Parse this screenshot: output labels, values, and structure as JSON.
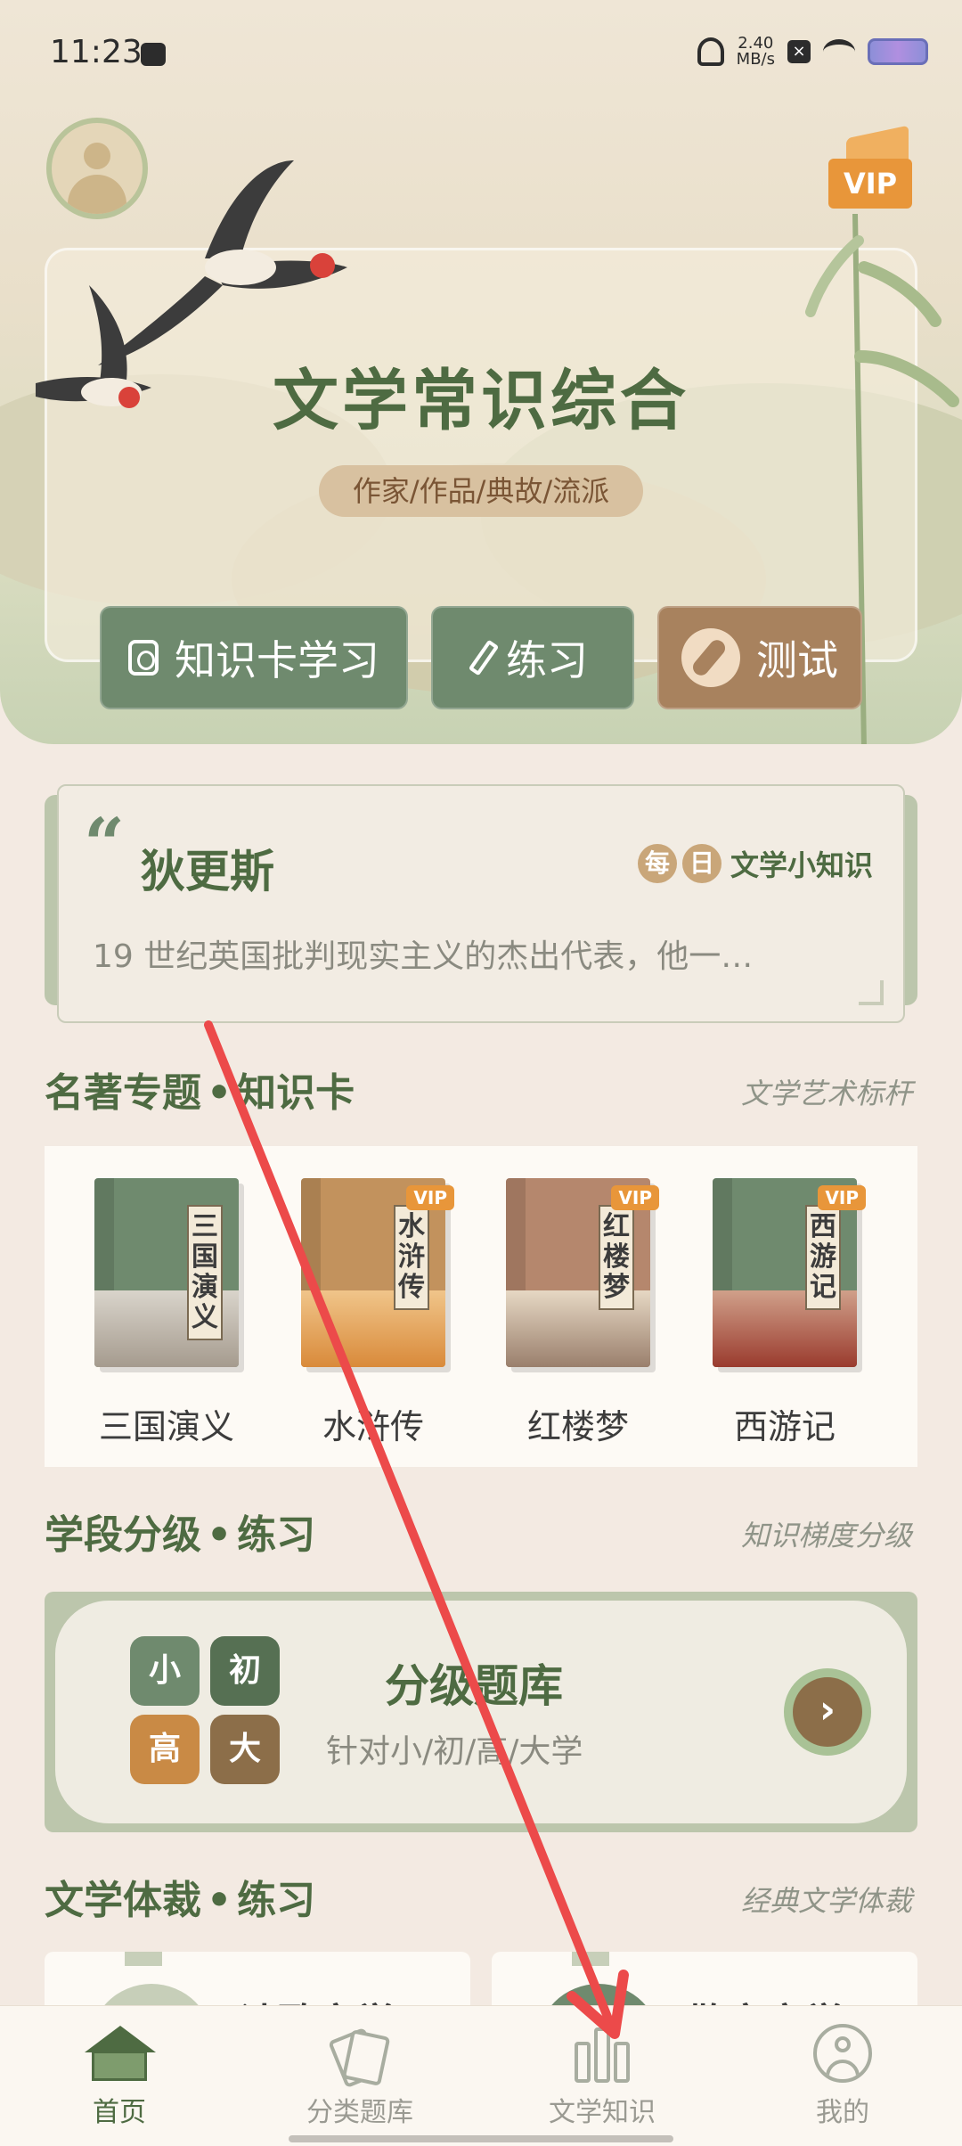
{
  "status_bar": {
    "time": "11:23",
    "speed_value": "2.40",
    "speed_unit": "MB/s",
    "x_label": "×"
  },
  "header": {
    "vip_label": "VIP"
  },
  "hero": {
    "title": "文学常识综合",
    "subtitle": "作家/作品/典故/流派",
    "buttons": {
      "cards": "知识卡学习",
      "practice": "练习",
      "test": "测试"
    }
  },
  "daily": {
    "quote_mark": "“",
    "title": "狄更斯",
    "tag_chars": [
      "每",
      "日"
    ],
    "tag_text": "文学小知识",
    "description": "19 世纪英国批判现实主义的杰出代表，他一…"
  },
  "famous_works": {
    "title": "名著专题",
    "dot": "•",
    "title_suffix": "知识卡",
    "subtitle": "文学艺术标杆",
    "books": [
      {
        "name": "三国演义",
        "cover_label": "三国演义",
        "vip": "",
        "color": "#6f8a6e"
      },
      {
        "name": "水浒传",
        "cover_label": "水浒传",
        "vip": "VIP",
        "color": "#c2925d"
      },
      {
        "name": "红楼梦",
        "cover_label": "红楼梦",
        "vip": "VIP",
        "color": "#b5876d"
      },
      {
        "name": "西游记",
        "cover_label": "西游记",
        "vip": "VIP",
        "color": "#6f8a6e"
      }
    ]
  },
  "grade": {
    "title": "学段分级",
    "dot": "•",
    "title_suffix": "练习",
    "subtitle": "知识梯度分级",
    "levels": [
      "小",
      "初",
      "高",
      "大"
    ],
    "bank_title": "分级题库",
    "bank_subtitle": "针对小/初/高/大学",
    "arrow": "›"
  },
  "genre": {
    "title": "文学体裁",
    "dot": "•",
    "title_suffix": "练习",
    "subtitle": "经典文学体裁",
    "cards": [
      "诗歌文学",
      "散文文学"
    ]
  },
  "nav": {
    "items": [
      {
        "label": "首页",
        "icon": "home-icon"
      },
      {
        "label": "分类题库",
        "icon": "cards-icon"
      },
      {
        "label": "文学知识",
        "icon": "books-icon"
      },
      {
        "label": "我的",
        "icon": "profile-icon"
      }
    ],
    "active_index": 0
  },
  "colors": {
    "accent_green": "#4e6b42",
    "button_green": "#6f8a6e",
    "button_brown": "#a8825e",
    "vip_orange": "#e8963a",
    "annotation_red": "#ec4a4a"
  }
}
